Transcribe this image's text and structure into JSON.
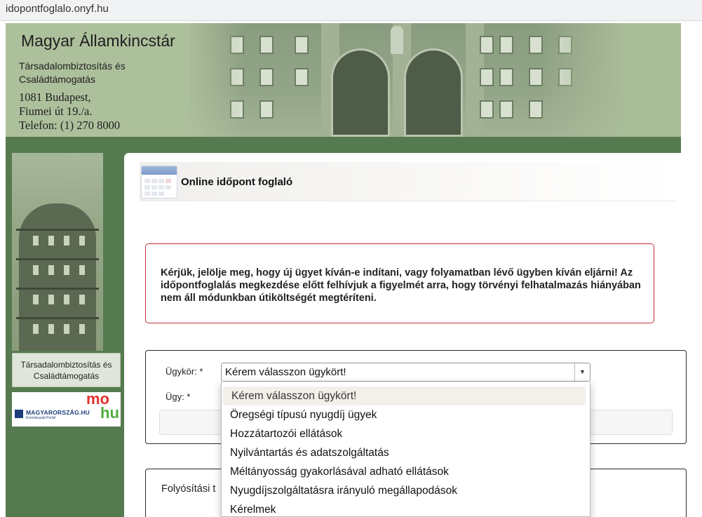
{
  "browser": {
    "url": "idopontfoglalo.onyf.hu"
  },
  "header": {
    "org_name": "Magyar Államkincstár",
    "org_sub_1": "Társadalombiztosítás és",
    "org_sub_2": "Családtámogatás",
    "addr_1": "1081 Budapest,",
    "addr_2": "Fiumei út 19./a.",
    "addr_3": "Telefon: (1) 270 8000"
  },
  "sidebar": {
    "label_1": "Társadalombiztosítás és",
    "label_2": "Családtámogatás",
    "banner_text": "MAGYARORSZÁG.HU",
    "banner_small": "Kormányzati Portál",
    "logo_top": "mo",
    "logo_bottom": "hu"
  },
  "main": {
    "title": "Online időpont foglaló",
    "alert_text": "Kérjük, jelölje meg, hogy új ügyet kíván-e indítani, vagy folyamatban lévő ügyben kíván eljárni! Az időpontfoglalás megkezdése előtt felhívjuk a figyelmét arra, hogy törvényi felhatalmazás hiányában nem áll módunkban útiköltségét megtéríteni.",
    "form": {
      "ugykor_label": "Ügykör: *",
      "ugy_label": "Ügy: *",
      "ugykor_value": "Kérem válasszon ügykört!"
    },
    "second_label": "Folyósítási t"
  },
  "dropdown": {
    "options": [
      "Kérem válasszon ügykört!",
      "Öregségi típusú nyugdíj ügyek",
      "Hozzátartozói ellátások",
      "Nyilvántartás és adatszolgáltatás",
      "Méltányosság gyakorlásával adható ellátások",
      "Nyugdíjszolgáltatásra irányuló megállapodások",
      "Kérelmek"
    ]
  }
}
